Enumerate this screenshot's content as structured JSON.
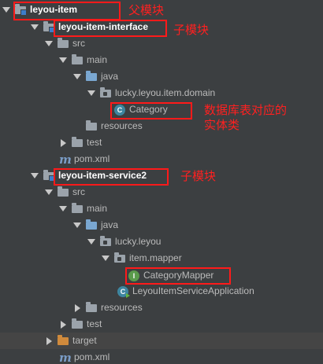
{
  "tree": {
    "root": "leyou-item",
    "interface_module": "leyou-item-interface",
    "service_module": "leyou-item-service2",
    "src": "src",
    "main": "main",
    "java": "java",
    "domain_package": "lucky.leyou.item.domain",
    "category_class": "Category",
    "resources": "resources",
    "test": "test",
    "pom": "pom.xml",
    "service_package": "lucky.leyou",
    "mapper_package": "item.mapper",
    "mapper_interface": "CategoryMapper",
    "application_class": "LeyouItemServiceApplication",
    "target": "target"
  },
  "annotations": {
    "parent_module": "父模块",
    "child_module_1": "子模块",
    "entity_line1": "数据库表对应的",
    "entity_line2": "实体类",
    "child_module_2": "子模块"
  },
  "icon_letters": {
    "class": "C",
    "interface": "I"
  },
  "colors": {
    "background": "#3c3f41",
    "text": "#bbbbbb",
    "highlight": "#ff1a1a",
    "module_marker": "#3d7dca",
    "class_icon": "#3e86a0",
    "interface_icon": "#5a9b4b",
    "target_folder": "#d08a3c"
  }
}
